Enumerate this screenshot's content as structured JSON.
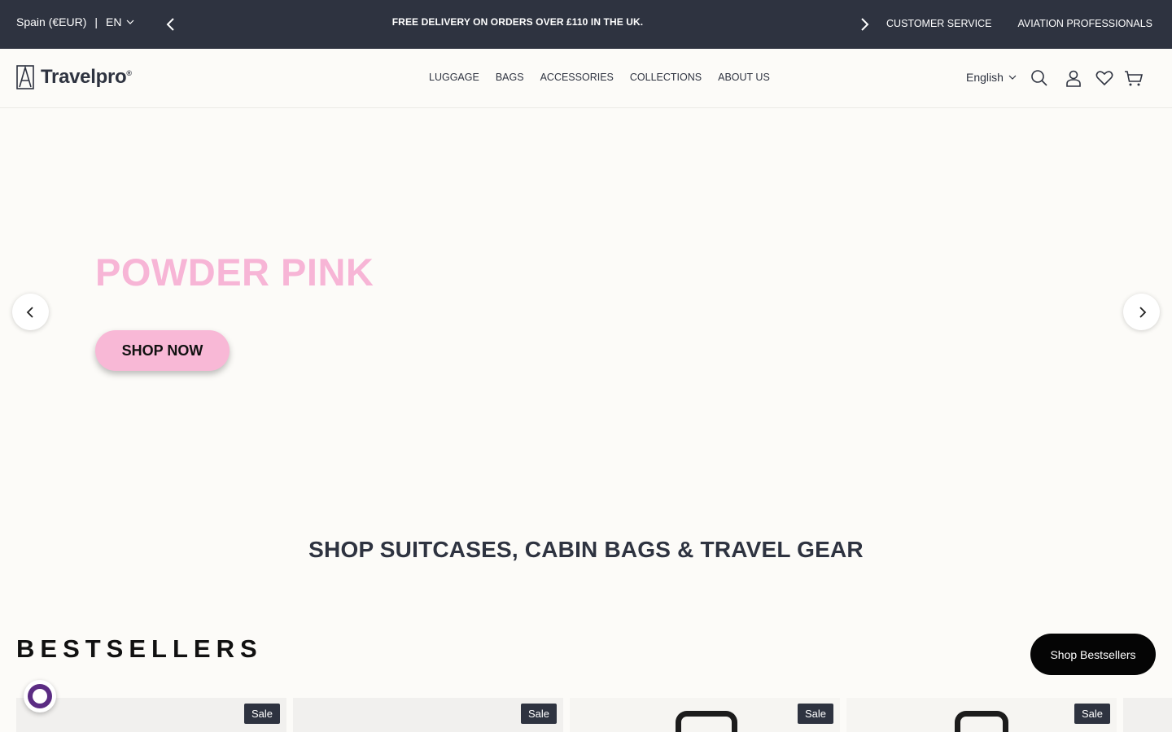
{
  "topbar": {
    "locale": "Spain (€EUR)",
    "separator": "|",
    "language_code": "EN",
    "announcement": "FREE DELIVERY ON ORDERS OVER £110 IN THE UK.",
    "links": [
      "CUSTOMER SERVICE",
      "AVIATION PROFESSIONALS"
    ],
    "background_color": "#2e3340"
  },
  "header": {
    "logo_text": "Travelpro",
    "logo_mark": "®",
    "nav": [
      "LUGGAGE",
      "BAGS",
      "ACCESSORIES",
      "COLLECTIONS",
      "ABOUT US"
    ],
    "language": "English",
    "icons": [
      "search-icon",
      "account-icon",
      "wishlist-icon",
      "cart-icon"
    ]
  },
  "hero": {
    "title": "POWDER PINK",
    "cta": "SHOP NOW",
    "accent_color": "#f7b5d6"
  },
  "headline": "SHOP SUITCASES, CABIN BAGS & TRAVEL GEAR",
  "bestsellers": {
    "title": "BESTSELLERS",
    "button": "Shop Bestsellers",
    "cards": [
      {
        "badge": "Sale"
      },
      {
        "badge": "Sale"
      },
      {
        "badge": "Sale"
      },
      {
        "badge": "Sale"
      }
    ]
  }
}
